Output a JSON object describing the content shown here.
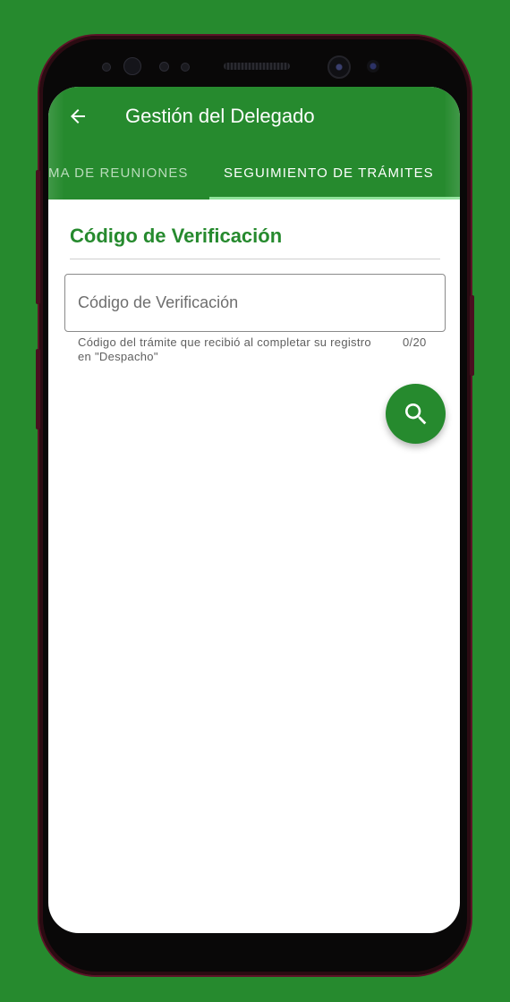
{
  "app_bar": {
    "title": "Gestión del Delegado"
  },
  "tabs": [
    {
      "label": "MA DE REUNIONES",
      "active": false
    },
    {
      "label": "SEGUIMIENTO DE TRÁMITES",
      "active": true
    }
  ],
  "section": {
    "title": "Código de Verificación"
  },
  "verification_field": {
    "placeholder": "Código de Verificación",
    "value": "",
    "helper_text": "Código del trámite que recibió al completar su registro en \"Despacho\"",
    "counter": "0/20"
  },
  "fab": {
    "icon": "search-icon"
  },
  "colors": {
    "background": "#268a2e",
    "primary": "#268a2e",
    "tab_indicator": "#8fe39a",
    "inactive_tab": "#b9dcbb"
  }
}
